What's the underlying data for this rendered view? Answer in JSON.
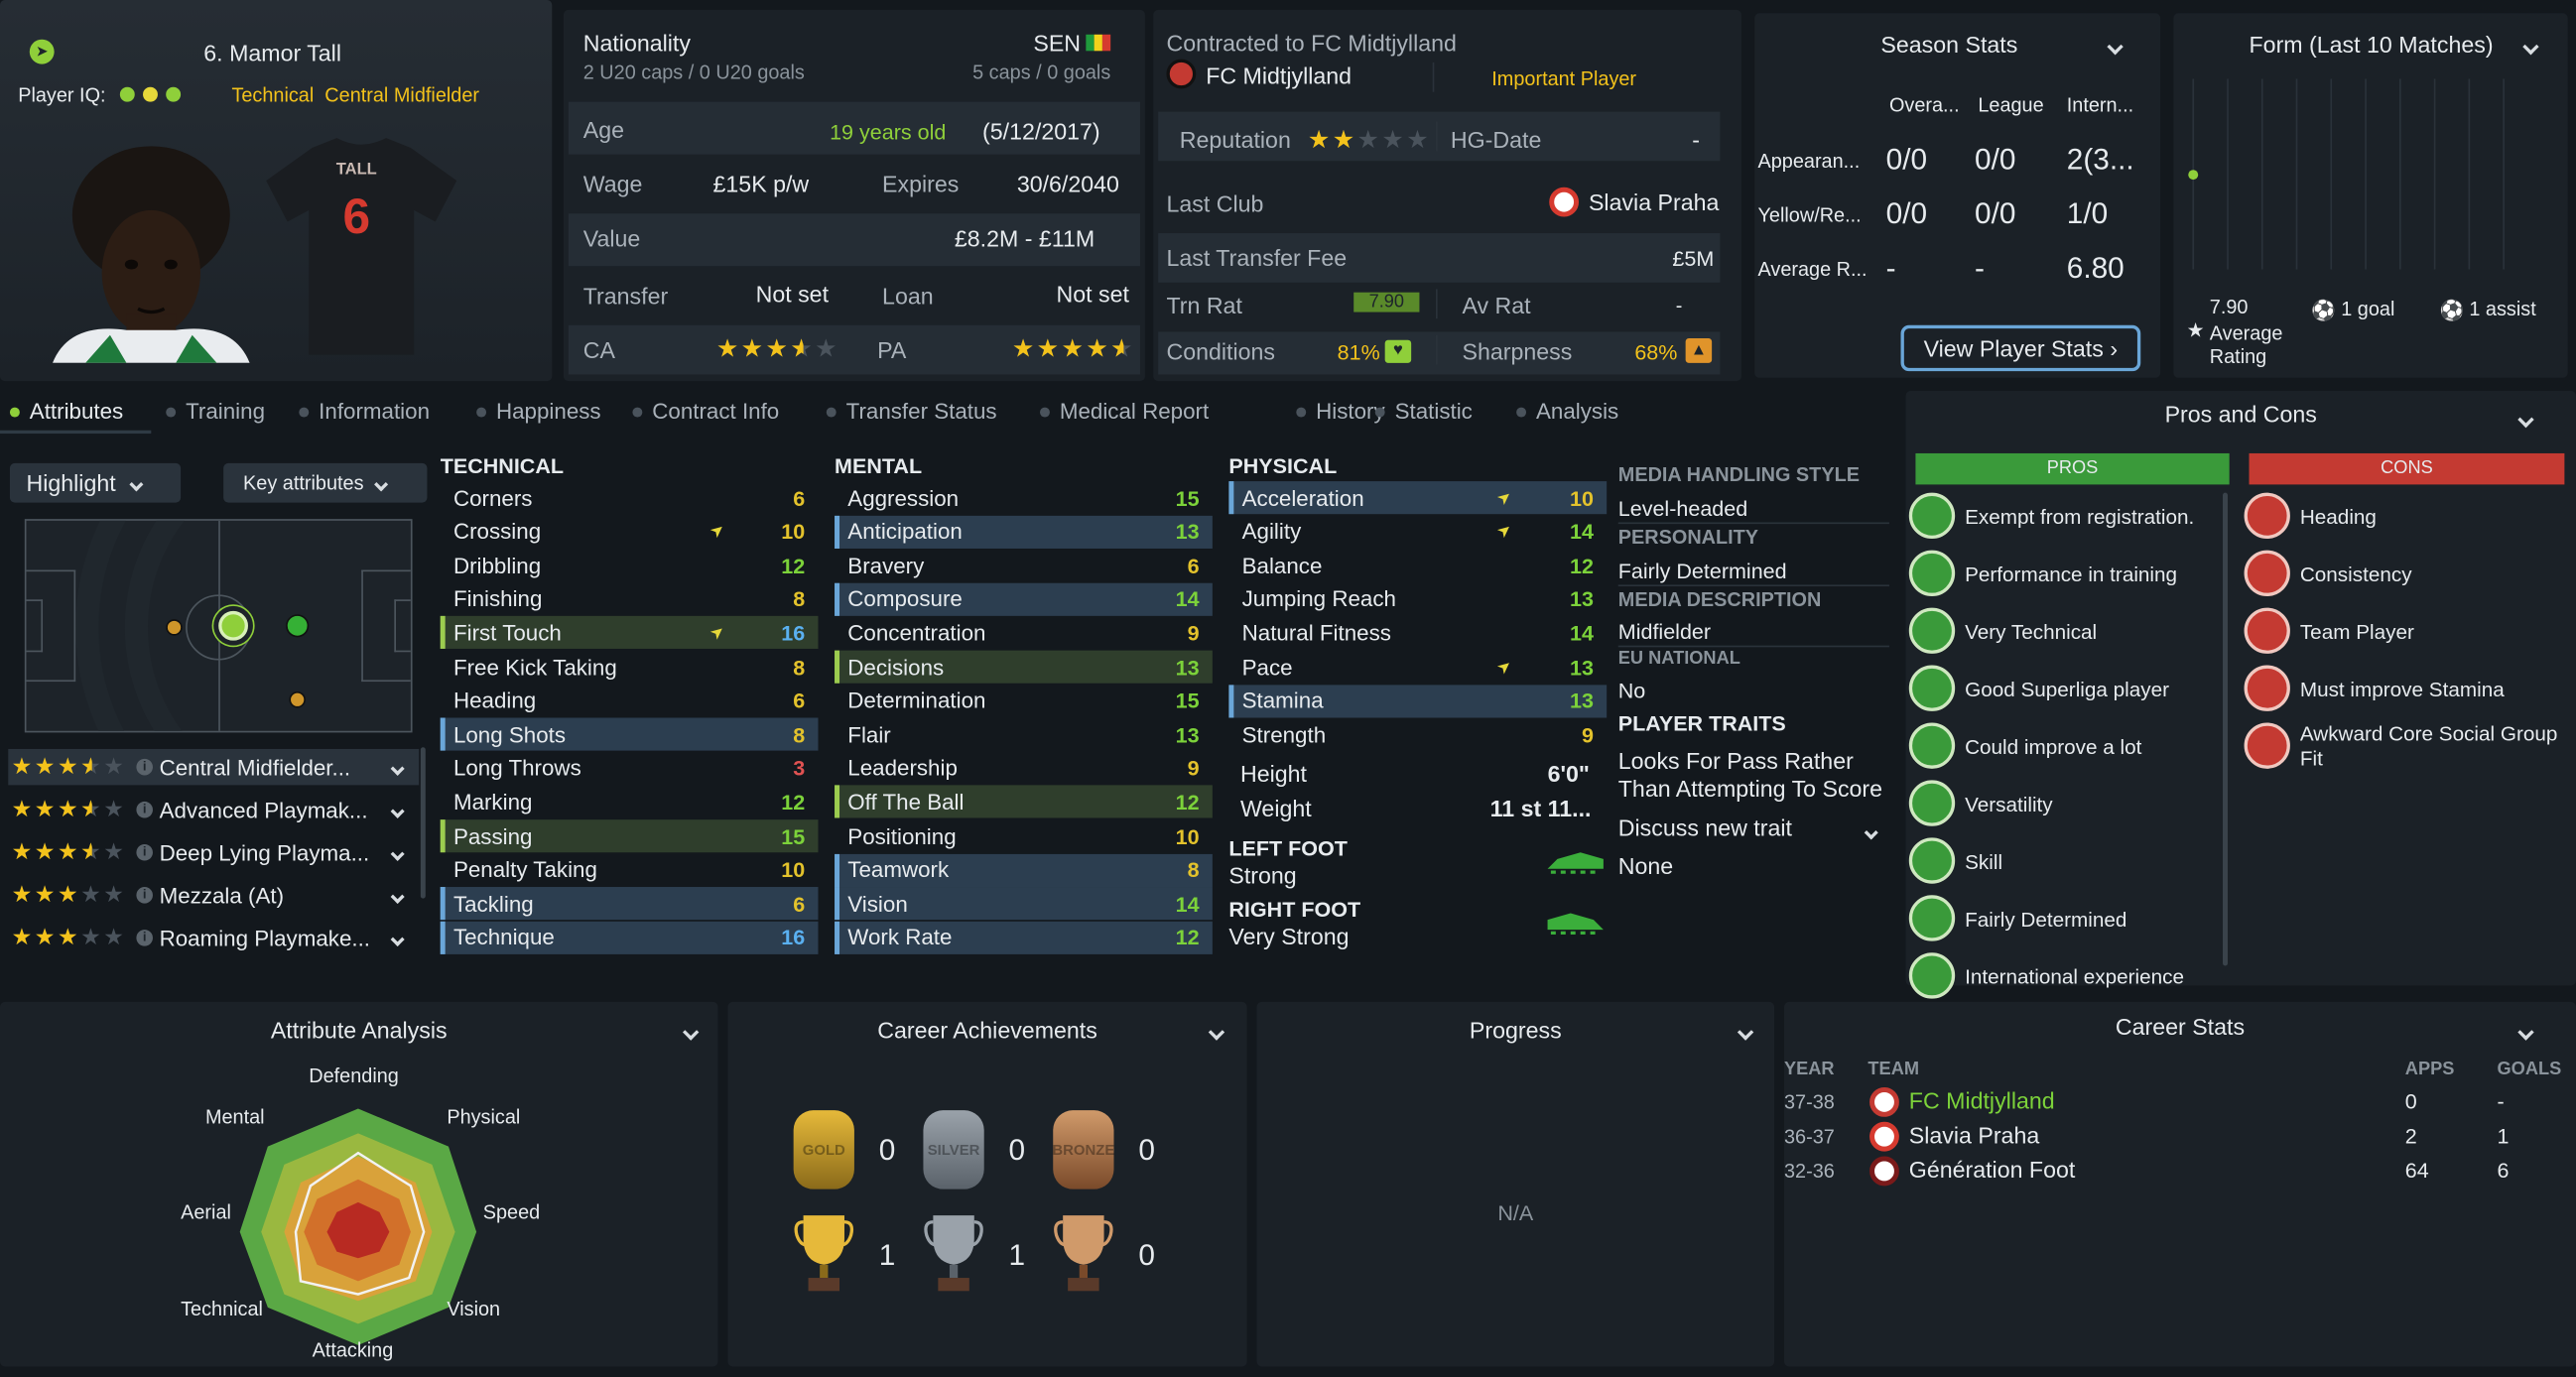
{
  "player": {
    "name": "6. Mamor Tall",
    "iq_label": "Player IQ:",
    "role": "Technical  Central Midfielder",
    "shirt_name": "TALL",
    "shirt_number": "6"
  },
  "info": {
    "nationality_label": "Nationality",
    "nationality_caps": "2 U20 caps / 0 U20 goals",
    "nation_code": "SEN",
    "nation_caps": "5 caps / 0 goals",
    "age_label": "Age",
    "age_value": "19 years old",
    "dob": "(5/12/2017)",
    "wage_label": "Wage",
    "wage_value": "£15K p/w",
    "expires_label": "Expires",
    "expires_value": "30/6/2040",
    "value_label": "Value",
    "value_value": "£8.2M - £11M",
    "transfer_label": "Transfer",
    "transfer_value": "Not set",
    "loan_label": "Loan",
    "loan_value": "Not set",
    "ca_label": "CA",
    "ca_stars": 3.5,
    "pa_label": "PA",
    "pa_stars": 4.5
  },
  "contract": {
    "contracted_to": "Contracted to FC Midtjylland",
    "club": "FC Midtjylland",
    "status": "Important Player",
    "reputation_label": "Reputation",
    "reputation_stars": 2,
    "hg_label": "HG-Date",
    "hg_value": "-",
    "last_club_label": "Last Club",
    "last_club_value": "Slavia Praha",
    "fee_label": "Last Transfer Fee",
    "fee_value": "£5M",
    "trn_label": "Trn Rat",
    "trn_value": "7.90",
    "av_label": "Av Rat",
    "av_value": "-",
    "cond_label": "Conditions",
    "cond_value": "81%",
    "sharp_label": "Sharpness",
    "sharp_value": "68%"
  },
  "season": {
    "title": "Season Stats",
    "cols": [
      "Overa...",
      "League",
      "Intern..."
    ],
    "rows": [
      {
        "label": "Appearan...",
        "vals": [
          "0/0",
          "0/0",
          "2(3..."
        ]
      },
      {
        "label": "Yellow/Re...",
        "vals": [
          "0/0",
          "0/0",
          "1/0"
        ]
      },
      {
        "label": "Average R...",
        "vals": [
          "-",
          "-",
          "6.80"
        ]
      }
    ],
    "button": "View Player Stats"
  },
  "form": {
    "title": "Form (Last 10 Matches)",
    "avg_value": "7.90",
    "avg_label": "Average Rating",
    "goals": "1 goal",
    "assists": "1 assist",
    "ratings": [
      7.9
    ]
  },
  "tabs": [
    "Attributes",
    "Training",
    "Information",
    "Happiness",
    "Contract Info",
    "Transfer Status",
    "Medical Report",
    "History",
    "Statistic",
    "Analysis"
  ],
  "left": {
    "highlight": "Highlight",
    "key_attributes": "Key attributes",
    "roles": [
      {
        "stars": 3.5,
        "name": "Central Midfielder..."
      },
      {
        "stars": 3.5,
        "name": "Advanced Playmak..."
      },
      {
        "stars": 3.5,
        "name": "Deep Lying Playma..."
      },
      {
        "stars": 3,
        "name": "Mezzala (At)"
      },
      {
        "stars": 3,
        "name": "Roaming Playmake..."
      }
    ]
  },
  "technical": {
    "title": "TECHNICAL",
    "items": [
      {
        "n": "Corners",
        "v": "6"
      },
      {
        "n": "Crossing",
        "v": "10"
      },
      {
        "n": "Dribbling",
        "v": "12"
      },
      {
        "n": "Finishing",
        "v": "8"
      },
      {
        "n": "First Touch",
        "v": "16"
      },
      {
        "n": "Free Kick Taking",
        "v": "8"
      },
      {
        "n": "Heading",
        "v": "6"
      },
      {
        "n": "Long Shots",
        "v": "8"
      },
      {
        "n": "Long Throws",
        "v": "3"
      },
      {
        "n": "Marking",
        "v": "12"
      },
      {
        "n": "Passing",
        "v": "15"
      },
      {
        "n": "Penalty Taking",
        "v": "10"
      },
      {
        "n": "Tackling",
        "v": "6"
      },
      {
        "n": "Technique",
        "v": "16"
      }
    ]
  },
  "mental": {
    "title": "MENTAL",
    "items": [
      {
        "n": "Aggression",
        "v": "15"
      },
      {
        "n": "Anticipation",
        "v": "13"
      },
      {
        "n": "Bravery",
        "v": "6"
      },
      {
        "n": "Composure",
        "v": "14"
      },
      {
        "n": "Concentration",
        "v": "9"
      },
      {
        "n": "Decisions",
        "v": "13"
      },
      {
        "n": "Determination",
        "v": "15"
      },
      {
        "n": "Flair",
        "v": "13"
      },
      {
        "n": "Leadership",
        "v": "9"
      },
      {
        "n": "Off The Ball",
        "v": "12"
      },
      {
        "n": "Positioning",
        "v": "10"
      },
      {
        "n": "Teamwork",
        "v": "8"
      },
      {
        "n": "Vision",
        "v": "14"
      },
      {
        "n": "Work Rate",
        "v": "12"
      }
    ]
  },
  "physical": {
    "title": "PHYSICAL",
    "items": [
      {
        "n": "Acceleration",
        "v": "10"
      },
      {
        "n": "Agility",
        "v": "14"
      },
      {
        "n": "Balance",
        "v": "12"
      },
      {
        "n": "Jumping Reach",
        "v": "13"
      },
      {
        "n": "Natural Fitness",
        "v": "14"
      },
      {
        "n": "Pace",
        "v": "13"
      },
      {
        "n": "Stamina",
        "v": "13"
      },
      {
        "n": "Strength",
        "v": "9"
      }
    ],
    "height_label": "Height",
    "height_value": "6'0\"",
    "weight_label": "Weight",
    "weight_value": "11 st 11...",
    "left_foot_label": "LEFT FOOT",
    "left_foot_value": "Strong",
    "right_foot_label": "RIGHT FOOT",
    "right_foot_value": "Very Strong"
  },
  "media": {
    "style_label": "MEDIA HANDLING STYLE",
    "style_value": "Level-headed",
    "personality_label": "PERSONALITY",
    "personality_value": "Fairly Determined",
    "desc_label": "MEDIA DESCRIPTION",
    "desc_value": "Midfielder",
    "eu_label": "EU NATIONAL",
    "eu_value": "No",
    "traits_label": "PLAYER TRAITS",
    "trait": "Looks For Pass Rather Than Attempting To Score",
    "discuss": "Discuss new trait",
    "none": "None"
  },
  "pros_cons": {
    "title": "Pros and Cons",
    "pros_label": "PROS",
    "cons_label": "CONS",
    "pros": [
      "Exempt from registration.",
      "Performance in training",
      "Very Technical",
      "Good Superliga player",
      "Could improve a lot",
      "Versatility",
      "Skill",
      "Fairly Determined",
      "International experience"
    ],
    "cons": [
      "Heading",
      "Consistency",
      "Team Player",
      "Must improve Stamina",
      "Awkward Core Social Group Fit"
    ]
  },
  "analysis": {
    "title": "Attribute Analysis",
    "labels": [
      "Defending",
      "Physical",
      "Speed",
      "Vision",
      "Attacking",
      "Technical",
      "Aerial",
      "Mental"
    ]
  },
  "achievements": {
    "title": "Career Achievements",
    "medals": [
      "GOLD",
      "SILVER",
      "BRONZE"
    ],
    "medal_counts": [
      "0",
      "0",
      "0"
    ],
    "trophy_counts": [
      "1",
      "1",
      "0"
    ]
  },
  "progress": {
    "title": "Progress",
    "value": "N/A"
  },
  "career": {
    "title": "Career Stats",
    "cols": [
      "YEAR",
      "TEAM",
      "APPS",
      "GOALS"
    ],
    "rows": [
      {
        "year": "37-38",
        "team": "FC Midtjylland",
        "apps": "0",
        "goals": "-"
      },
      {
        "year": "36-37",
        "team": "Slavia Praha",
        "apps": "2",
        "goals": "1"
      },
      {
        "year": "32-36",
        "team": "Génération Foot",
        "apps": "64",
        "goals": "6"
      }
    ]
  },
  "colors": {
    "accent_green": "#7cd23a",
    "accent_yellow": "#f3c21b",
    "pros_green": "#3a9a3a",
    "cons_red": "#c43a32",
    "highlight_blue": "#2c3e50"
  }
}
